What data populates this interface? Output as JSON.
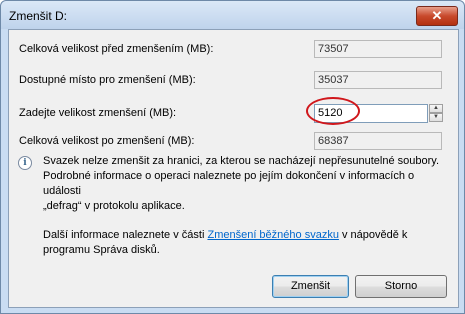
{
  "window": {
    "title": "Zmenšit D:"
  },
  "fields": {
    "total_before_label": "Celková velikost před zmenšením (MB):",
    "total_before_value": "73507",
    "available_label": "Dostupné místo pro zmenšení (MB):",
    "available_value": "35037",
    "shrink_label": "Zadejte velikost zmenšení (MB):",
    "shrink_value": "5120",
    "total_after_label": "Celková velikost po zmenšení (MB):",
    "total_after_value": "68387"
  },
  "note": {
    "line1": "Svazek nelze zmenšit za hranici, za kterou se nacházejí nepřesunutelné soubory.",
    "line2": "Podrobné informace o operaci naleznete po jejím dokončení v informacích o události",
    "line3": "„defrag“ v protokolu aplikace."
  },
  "more_info": {
    "prefix": "Další informace naleznete v části ",
    "link": "Zmenšení běžného svazku",
    "suffix": " v nápovědě k",
    "line2": "programu Správa disků."
  },
  "buttons": {
    "shrink": "Zmenšit",
    "cancel": "Storno"
  },
  "icons": {
    "close": "close-icon",
    "info": "info-icon",
    "spin_up": "chevron-up-icon",
    "spin_down": "chevron-down-icon"
  }
}
